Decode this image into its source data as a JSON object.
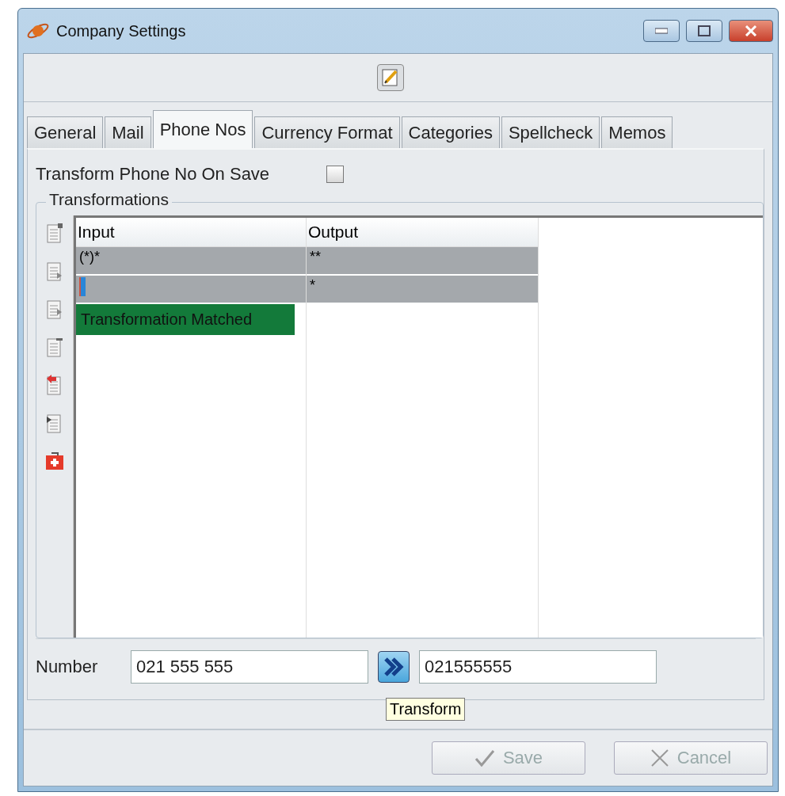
{
  "window": {
    "title": "Company Settings"
  },
  "tabs": [
    {
      "label": "General",
      "selected": false
    },
    {
      "label": "Mail",
      "selected": false
    },
    {
      "label": "Phone Nos",
      "selected": true
    },
    {
      "label": "Currency Format",
      "selected": false
    },
    {
      "label": "Categories",
      "selected": false
    },
    {
      "label": "Spellcheck",
      "selected": false
    },
    {
      "label": "Memos",
      "selected": false
    }
  ],
  "transform_on_save": {
    "label": "Transform Phone No On Save",
    "checked": false
  },
  "transformations": {
    "title": "Transformations",
    "columns": [
      "Input",
      "Output"
    ],
    "rows": [
      {
        "input": "(*)*",
        "output": "**",
        "editing": false
      },
      {
        "input": "",
        "output": "*",
        "editing": true
      }
    ],
    "status": "Transformation Matched"
  },
  "number": {
    "label": "Number",
    "value": "021 555 555",
    "result": "021555555",
    "tooltip": "Transform"
  },
  "buttons": [
    {
      "label": "Save",
      "kind": "save",
      "disabled": true
    },
    {
      "label": "Cancel",
      "kind": "cancel",
      "disabled": true
    }
  ]
}
